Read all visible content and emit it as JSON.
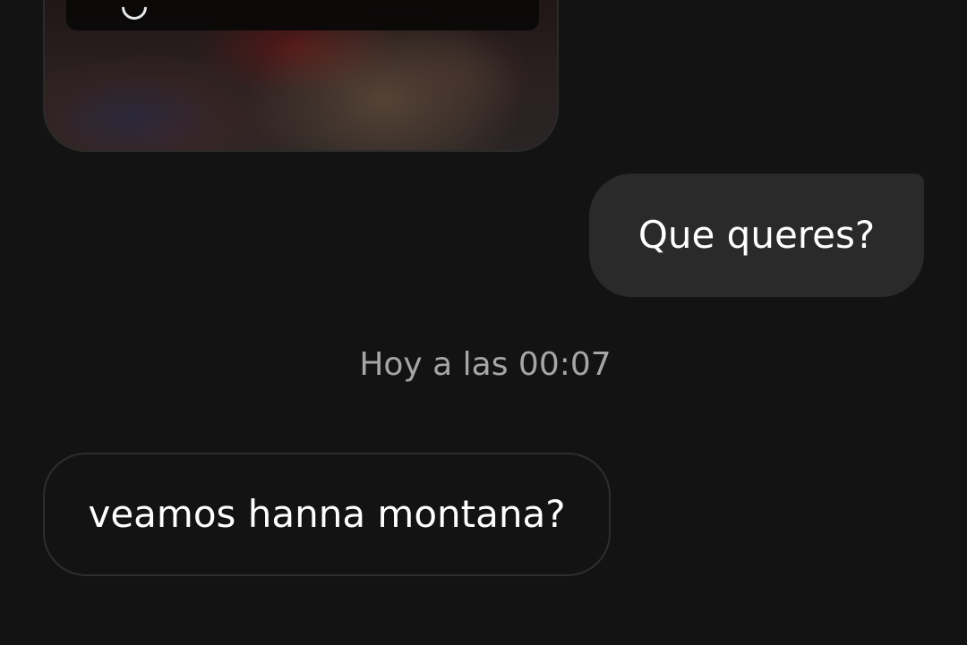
{
  "conversation": {
    "shared_media": {
      "icon": "loading-ring-icon"
    },
    "messages": [
      {
        "direction": "sent",
        "text": "Que queres?"
      },
      {
        "direction": "received",
        "text": "veamos hanna montana?"
      }
    ],
    "timestamp": "Hoy a las 00:07"
  },
  "theme": {
    "background": "#131313",
    "sent_bubble": "#2a2a2a",
    "received_border": "#2e2e2e",
    "text": "#ffffff",
    "timestamp_text": "#a6a6a6"
  }
}
